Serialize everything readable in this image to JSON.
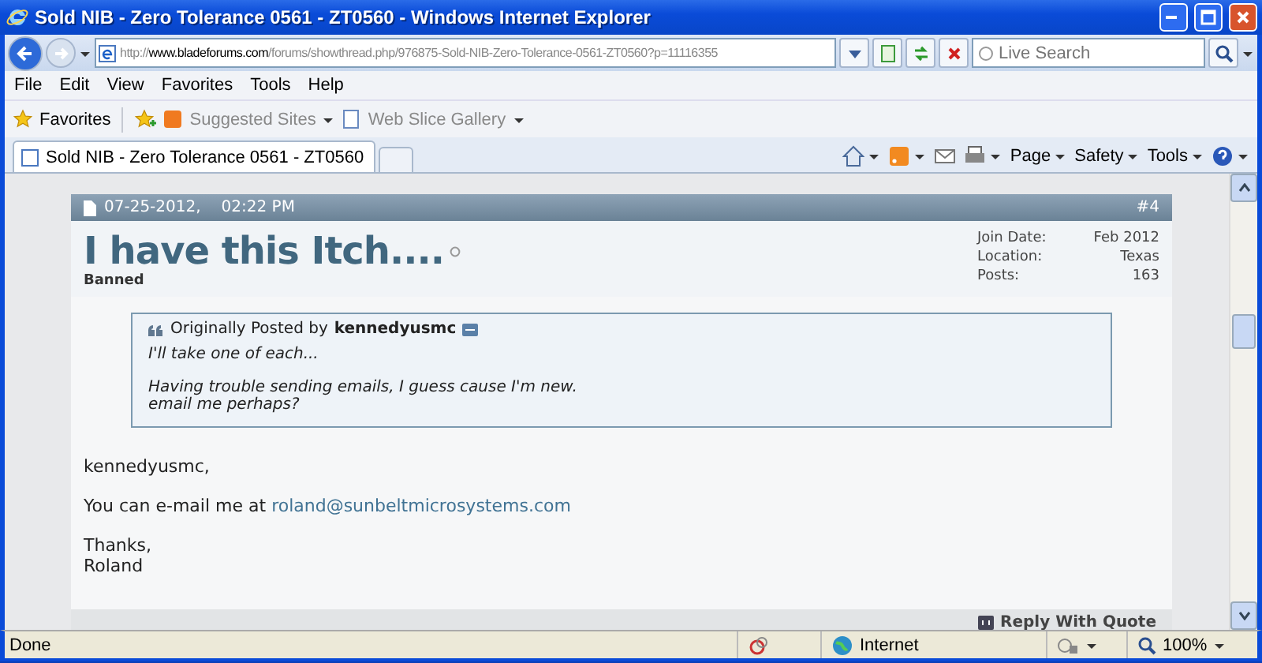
{
  "window": {
    "title": "Sold NIB - Zero Tolerance 0561 - ZT0560 - Windows Internet Explorer"
  },
  "address_bar": {
    "url": "http://**www.bladeforums.com**/forums/showthread.php/976875-Sold-NIB-Zero-Tolerance-0561-ZT0560?p=11116355"
  },
  "search": {
    "placeholder": "Live Search"
  },
  "menu": [
    "File",
    "Edit",
    "View",
    "Favorites",
    "Tools",
    "Help"
  ],
  "favorites_bar": {
    "favorites": "Favorites",
    "links": [
      "Suggested Sites",
      "Web Slice Gallery"
    ]
  },
  "tabs": [
    {
      "label": "Sold NIB - Zero Tolerance 0561 - ZT0560",
      "selected": true
    }
  ],
  "command_bar": [
    "Page",
    "Safety",
    "Tools"
  ],
  "post": {
    "date": "07-25-2012,",
    "time": "02:22 PM",
    "number": "#4",
    "username": "I have this Itch....",
    "online": false,
    "user_title": "Banned",
    "user_info": [
      {
        "label": "Join Date:",
        "value": "Feb 2012"
      },
      {
        "label": "Location:",
        "value": "Texas"
      },
      {
        "label": "Posts:",
        "value": "163"
      }
    ],
    "quote": {
      "prefix": "Originally Posted by",
      "author": "kennedyusmc",
      "paragraphs": [
        [
          "I'll take one of each..."
        ],
        [
          "Having trouble sending emails, I guess cause I'm new.",
          "email me perhaps?"
        ]
      ]
    },
    "body": [
      {
        "lines": [
          "kennedyusmc,"
        ]
      },
      {
        "lines": [
          "You can e-mail me at"
        ],
        "link": "roland@sunbeltmicrosystems.com"
      },
      {
        "lines": [
          "Thanks,",
          "Roland"
        ]
      }
    ],
    "reply": "Reply With Quote"
  },
  "status_bar": {
    "text": "Done",
    "zone": "Internet",
    "zoom": "100%"
  }
}
